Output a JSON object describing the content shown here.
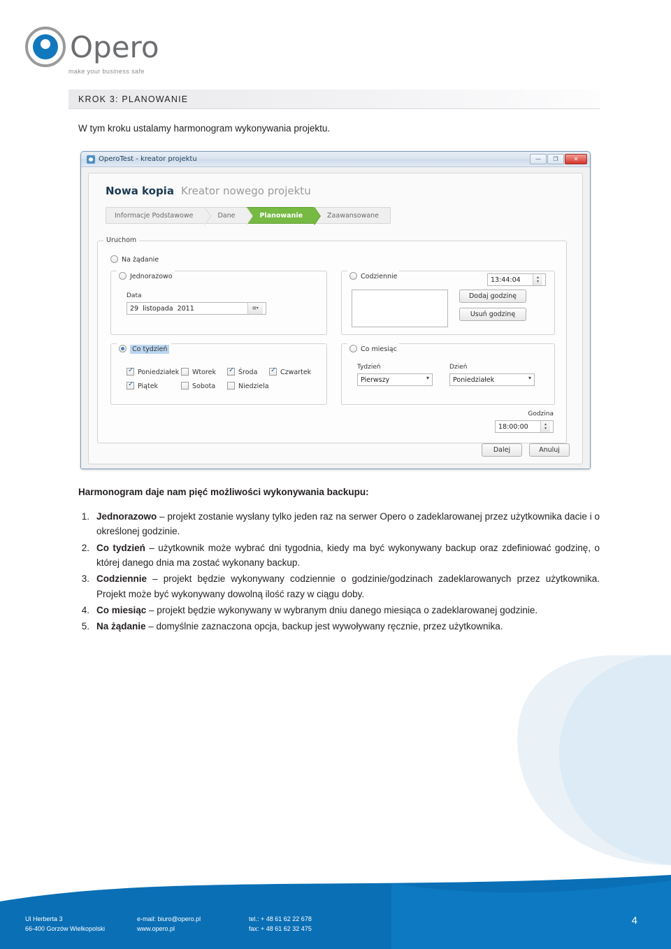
{
  "brand": {
    "name": "Opero",
    "tagline": "make your business safe"
  },
  "step_bar": {
    "title": "KROK 3: PLANOWANIE"
  },
  "intro": "W tym kroku ustalamy harmonogram wykonywania projektu.",
  "screenshot": {
    "window_title": "OperoTest - kreator projektu",
    "window_buttons": {
      "minimize": "—",
      "maximize": "❐",
      "close": "✕"
    },
    "wizard_title": "Nowa kopia",
    "wizard_subtitle": "Kreator nowego projektu",
    "crumbs": [
      {
        "label": "Informacje Podstawowe",
        "active": false
      },
      {
        "label": "Dane",
        "active": false
      },
      {
        "label": "Planowanie",
        "active": true
      },
      {
        "label": "Zaawansowane",
        "active": false
      }
    ],
    "group_uruchom": "Uruchom",
    "on_demand": "Na żądanie",
    "once": {
      "legend": "Jednorazowo",
      "data_label": "Data",
      "date_day": "29",
      "date_month": "listopada",
      "date_year": "2011"
    },
    "daily": {
      "legend": "Codziennie",
      "time": "13:44:04",
      "add_button": "Dodaj godzinę",
      "remove_button": "Usuń godzinę"
    },
    "weekly": {
      "legend": "Co tydzień",
      "days": [
        {
          "label": "Poniedziałek",
          "checked": true
        },
        {
          "label": "Wtorek",
          "checked": false
        },
        {
          "label": "Środa",
          "checked": true
        },
        {
          "label": "Czwartek",
          "checked": true
        },
        {
          "label": "Piątek",
          "checked": true
        },
        {
          "label": "Sobota",
          "checked": false
        },
        {
          "label": "Niedziela",
          "checked": false
        }
      ]
    },
    "monthly": {
      "legend": "Co miesiąc",
      "week_label": "Tydzień",
      "week_value": "Pierwszy",
      "day_label": "Dzień",
      "day_value": "Poniedziałek",
      "hour_label": "Godzina",
      "hour_value": "18:00:00"
    },
    "next_button": "Dalej",
    "cancel_button": "Anuluj"
  },
  "lead": "Harmonogram daje nam pięć możliwości wykonywania backupu:",
  "list": [
    {
      "num": "1.",
      "bold": "Jednorazowo",
      "text": " – projekt zostanie wysłany tylko jeden raz na serwer Opero o zadeklarowanej przez użytkownika dacie i o określonej godzinie."
    },
    {
      "num": "2.",
      "bold": "Co tydzień",
      "text": " – użytkownik może wybrać dni tygodnia, kiedy ma być wykonywany backup oraz zdefiniować godzinę, o której danego dnia ma zostać wykonany backup."
    },
    {
      "num": "3.",
      "bold": "Codziennie",
      "text": " – projekt będzie wykonywany codziennie o godzinie/godzinach zadeklarowanych przez użytkownika. Projekt może być wykonywany dowolną ilość razy w ciągu doby."
    },
    {
      "num": "4.",
      "bold": "Co miesiąc",
      "text": " – projekt będzie wykonywany w wybranym dniu danego miesiąca o zadeklarowanej godzinie."
    },
    {
      "num": "5.",
      "bold": "Na żądanie",
      "text": " – domyślnie zaznaczona opcja, backup jest wywoływany ręcznie, przez użytkownika."
    }
  ],
  "footer": {
    "address_line1": "Ul Herberta 3",
    "address_line2": "66-400 Gorzów Wielkopolski",
    "email_line1": "e-mail: biuro@opero.pl",
    "email_line2": "www.opero.pl",
    "phone_line1": "tel.: + 48 61 62 22 678",
    "phone_line2": "fax: + 48 61 62 32 475",
    "page": "4"
  },
  "colors": {
    "accent": "#0a6fb5",
    "active_step": "#76b943",
    "footer_bg": "#0a6fb5"
  }
}
